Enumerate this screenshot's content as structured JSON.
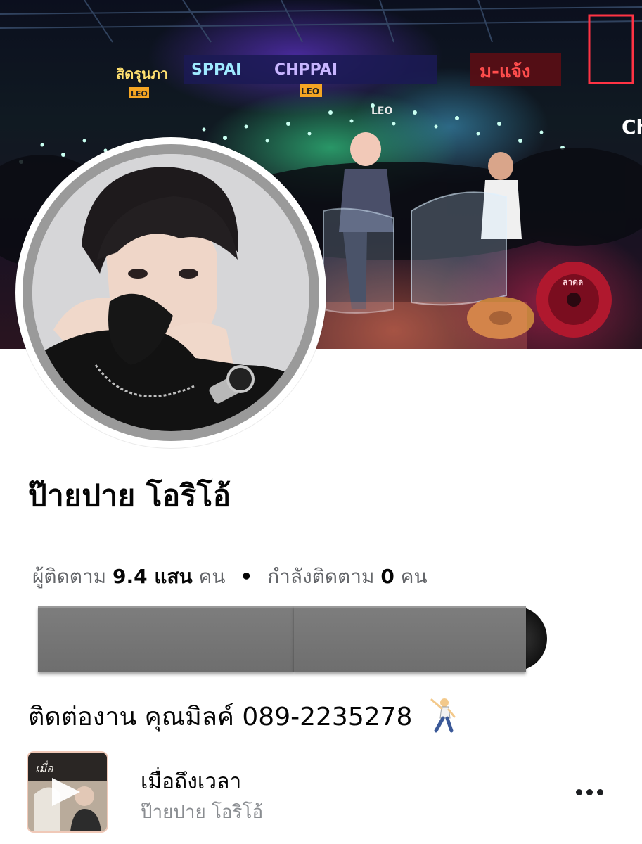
{
  "profile": {
    "name": "ป๊ายปาย โอริโอ้"
  },
  "stats": {
    "followers_label": "ผู้ติดตาม",
    "followers_value": "9.4 แสน",
    "followers_unit": "คน",
    "separator": "•",
    "following_label": "กำลังติดตาม",
    "following_value": "0",
    "following_unit": "คน"
  },
  "contact": {
    "text": "ติดต่องาน คุณมิลค์ 089-2235278"
  },
  "music": {
    "title": "เมื่อถึงเวลา",
    "artist": "ป๊ายปาย โอริโอ้"
  },
  "cover": {
    "signs": [
      "SPPAI",
      "CHPPAI",
      "LEO",
      "LEO",
      "LEO",
      "Ch"
    ]
  },
  "icons": {
    "more": "more-horizontal-icon",
    "play": "play-icon",
    "dancer": "man-dancing-emoji"
  },
  "colors": {
    "secondary_text": "#65676b",
    "muted_text": "#8a8d91",
    "primary_text": "#050505",
    "redaction": "#737373"
  }
}
